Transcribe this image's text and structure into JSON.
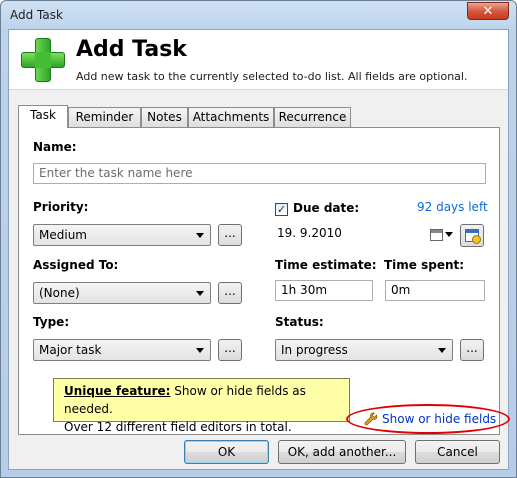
{
  "window": {
    "title": "Add Task",
    "close_label": "✕"
  },
  "header": {
    "title": "Add Task",
    "subtitle": "Add new task to the currently selected to-do list. All fields are optional.",
    "icon": "add-plus-icon"
  },
  "tabs": [
    "Task",
    "Reminder",
    "Notes",
    "Attachments",
    "Recurrence"
  ],
  "active_tab": "Task",
  "fields": {
    "name": {
      "label": "Name:",
      "placeholder": "Enter the task name here"
    },
    "priority": {
      "label": "Priority:",
      "value": "Medium"
    },
    "due_date": {
      "label": "Due date:",
      "checked": true,
      "value": "19.  9.2010",
      "days_left": "92 days left"
    },
    "assigned_to": {
      "label": "Assigned To:",
      "value": "(None)"
    },
    "time_estimate": {
      "label": "Time estimate:",
      "value": "1h 30m"
    },
    "time_spent": {
      "label": "Time spent:",
      "value": "0m"
    },
    "type": {
      "label": "Type:",
      "value": "Major task"
    },
    "status": {
      "label": "Status:",
      "value": "In progress"
    }
  },
  "ellipsis_label": "...",
  "tooltip": {
    "feature_label": "Unique feature:",
    "line1": " Show or hide fields as needed.",
    "line2": "Over 12 different field editors in total."
  },
  "show_hide_link": "Show or hide fields",
  "buttons": {
    "ok": "OK",
    "ok_add_another": "OK, add another...",
    "cancel": "Cancel"
  },
  "colors": {
    "accent_link": "#0d6ad8",
    "tooltip_bg": "#ffffa8",
    "highlight_ring": "#e00000"
  }
}
